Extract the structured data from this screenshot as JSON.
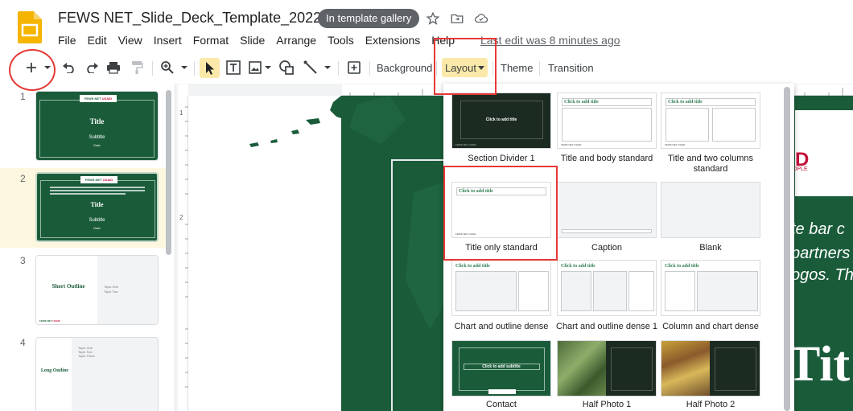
{
  "app": {
    "doc_title": "FEWS NET_Slide_Deck_Template_2022",
    "gallery_badge": "In template gallery",
    "last_edit": "Last edit was 8 minutes ago"
  },
  "menu": [
    "File",
    "Edit",
    "View",
    "Insert",
    "Format",
    "Slide",
    "Arrange",
    "Tools",
    "Extensions",
    "Help"
  ],
  "toolbar": {
    "background": "Background",
    "layout": "Layout",
    "theme": "Theme",
    "transition": "Transition"
  },
  "ruler": {
    "left_marks": [
      "1",
      "2"
    ]
  },
  "slides": [
    {
      "num": "1",
      "title": "Title",
      "subtitle": "Subtitle",
      "footer": "Date"
    },
    {
      "num": "2",
      "title": "Title",
      "subtitle": "Subtitle",
      "footer": "Date"
    },
    {
      "num": "3",
      "title": "Short Outline",
      "items": [
        "Topic One",
        "Topic Two"
      ]
    },
    {
      "num": "4",
      "title": "Long Outline",
      "items": [
        "Topic One",
        "Topic Two",
        "Topic Three"
      ]
    }
  ],
  "logos": {
    "fewsnet": "FEWS NET",
    "usaid": "USAID"
  },
  "canvas": {
    "usaid_fragment": "D",
    "people_fragment": "OPLE",
    "lines": [
      "te bar c",
      "partners",
      "ogos. Th"
    ],
    "big_title": "Tit"
  },
  "layouts": [
    {
      "label": "Section Divider 1",
      "mini": "Click to add title"
    },
    {
      "label": "Title and body standard",
      "mini": "Click to add title"
    },
    {
      "label": "Title and two columns standard",
      "mini": "Click to add title"
    },
    {
      "label": "Title only standard",
      "mini": "Click to add title"
    },
    {
      "label": "Caption",
      "mini": ""
    },
    {
      "label": "Blank",
      "mini": ""
    },
    {
      "label": "Chart and outline dense",
      "mini": "Click to add title"
    },
    {
      "label": "Chart and outline dense 1",
      "mini": "Click to add title"
    },
    {
      "label": "Column and chart dense",
      "mini": "Click to add title"
    },
    {
      "label": "Contact",
      "mini": "Click to add subtitle"
    },
    {
      "label": "Half Photo 1",
      "mini": ""
    },
    {
      "label": "Half Photo 2",
      "mini": ""
    }
  ],
  "colors": {
    "brand_green": "#1a5c3a",
    "highlight_yellow": "#fbe9a9",
    "annotation_red": "#e53935",
    "usaid_red": "#c2113a"
  }
}
